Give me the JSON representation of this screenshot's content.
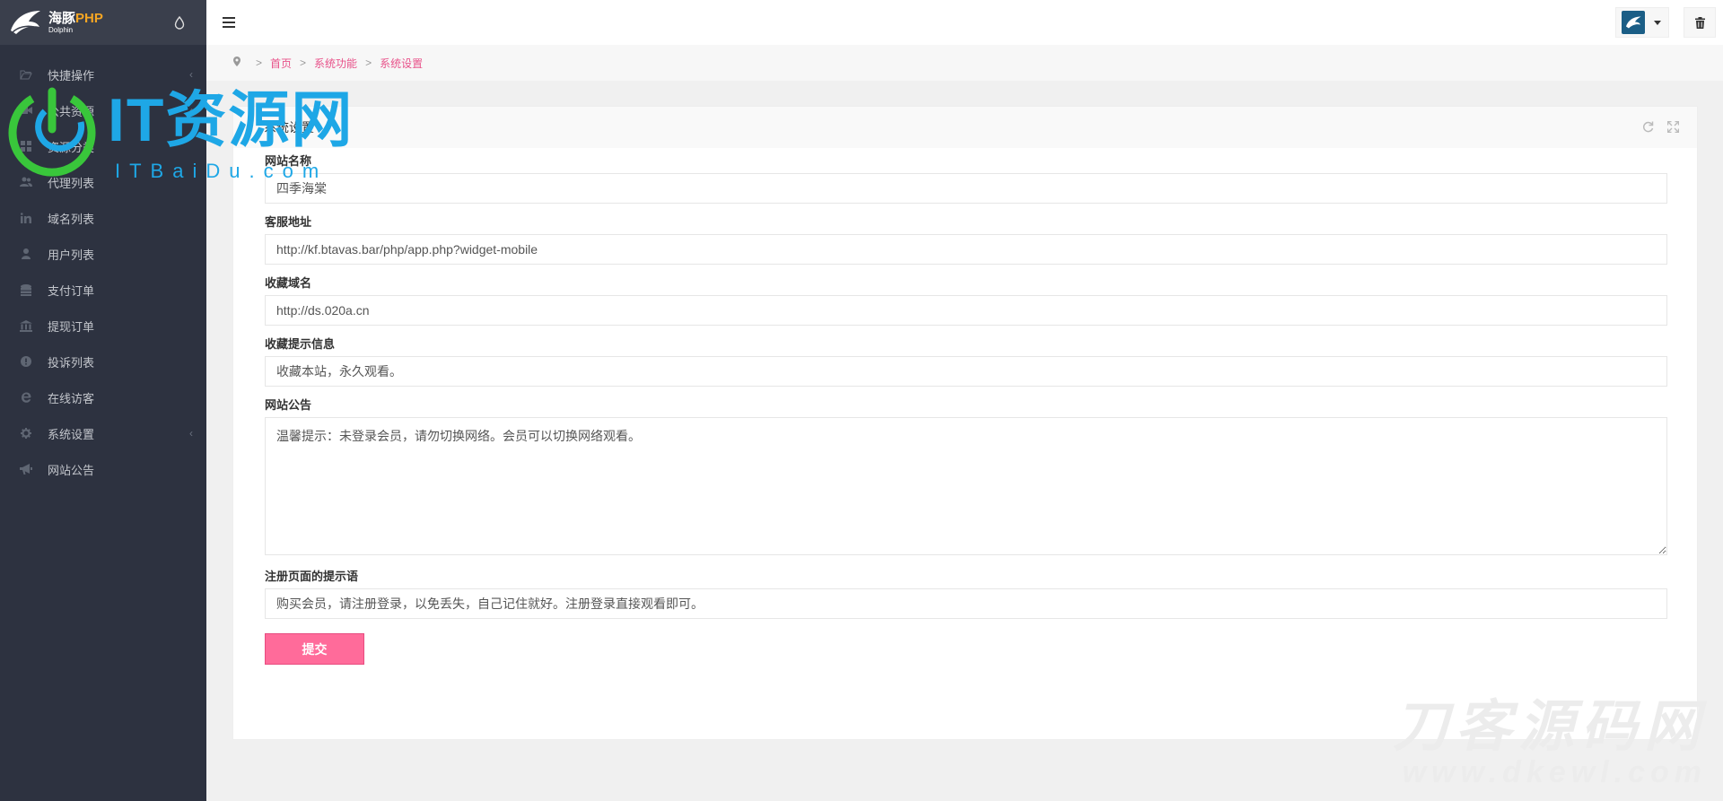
{
  "brand": {
    "name_cn": "海豚",
    "name_php": "PHP",
    "name_en": "Dolphin"
  },
  "sidebar": {
    "items": [
      {
        "label": "快捷操作",
        "icon": "folder-open-icon",
        "chevron": true
      },
      {
        "label": "公共资源",
        "icon": "video-camera-icon",
        "chevron": true
      },
      {
        "label": "资源分类",
        "icon": "grid-icon",
        "chevron": false
      },
      {
        "label": "代理列表",
        "icon": "users-icon",
        "chevron": false
      },
      {
        "label": "域名列表",
        "icon": "linkedin-icon",
        "chevron": false
      },
      {
        "label": "用户列表",
        "icon": "user-icon",
        "chevron": false
      },
      {
        "label": "支付订单",
        "icon": "database-icon",
        "chevron": false
      },
      {
        "label": "提现订单",
        "icon": "bank-icon",
        "chevron": false
      },
      {
        "label": "投诉列表",
        "icon": "exclamation-circle-icon",
        "chevron": false
      },
      {
        "label": "在线访客",
        "icon": "ie-icon",
        "chevron": false
      },
      {
        "label": "系统设置",
        "icon": "gear-icon",
        "chevron": true
      },
      {
        "label": "网站公告",
        "icon": "bullhorn-icon",
        "chevron": false
      }
    ]
  },
  "breadcrumb": {
    "items": [
      "首页",
      "系统功能",
      "系统设置"
    ],
    "separator": ">"
  },
  "panel": {
    "title": "系统设置"
  },
  "form": {
    "site_name": {
      "label": "网站名称",
      "value": "四季海棠"
    },
    "service_url": {
      "label": "客服地址",
      "value": "http://kf.btavas.bar/php/app.php?widget-mobile"
    },
    "bookmark_domain": {
      "label": "收藏域名",
      "value": "http://ds.020a.cn"
    },
    "bookmark_tip": {
      "label": "收藏提示信息",
      "value": "收藏本站，永久观看。"
    },
    "announcement": {
      "label": "网站公告",
      "value": "温馨提示：未登录会员，请勿切换网络。会员可以切换网络观看。"
    },
    "register_tip": {
      "label": "注册页面的提示语",
      "value": "购买会员，请注册登录，以免丢失，自己记住就好。注册登录直接观看即可。"
    },
    "submit_label": "提交"
  },
  "watermarks": {
    "it_title": "IT资源网",
    "it_sub": "ITBaiDu.com",
    "dk_title": "刀客源码网",
    "dk_url": "www.dkewl.com"
  },
  "colors": {
    "sidebar_bg": "#2d3240",
    "accent_pink": "#ff6b9a",
    "link_pink": "#e8528a",
    "watermark_blue": "#1ea7e6"
  }
}
